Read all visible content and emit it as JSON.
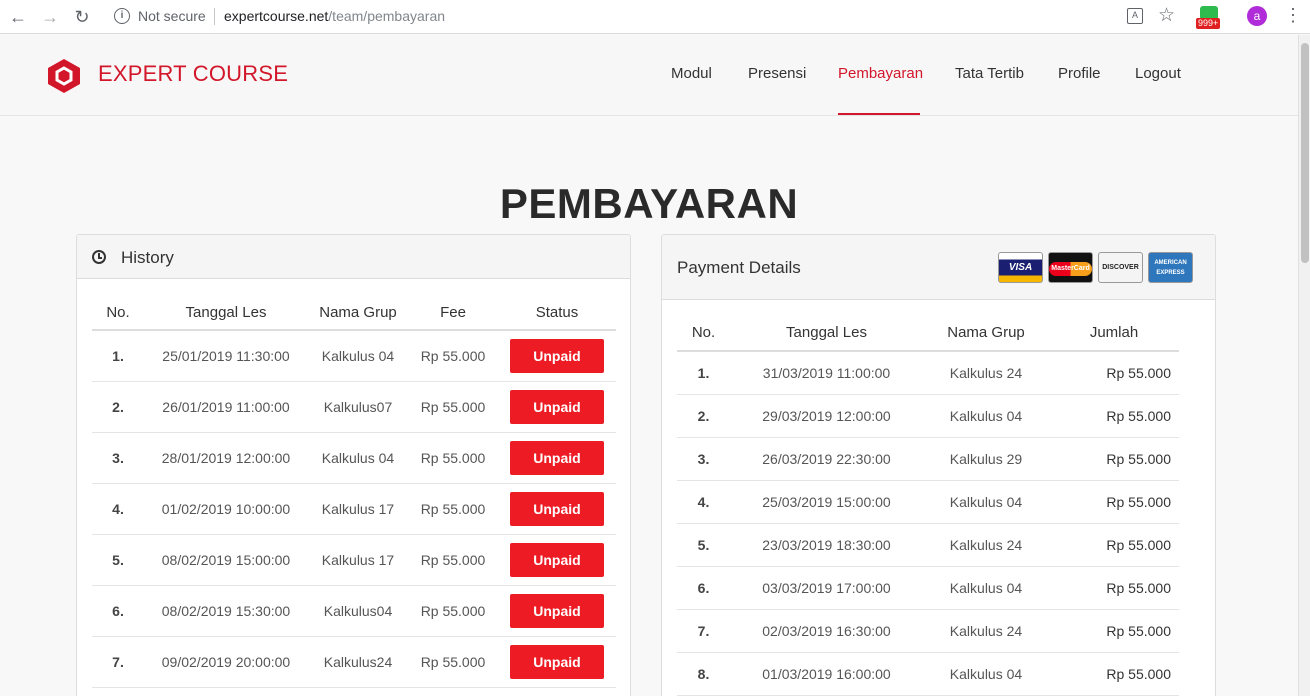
{
  "browser": {
    "security_text": "Not secure",
    "url_domain": "expertcourse.net",
    "url_path": "/team/pembayaran",
    "extension_badge": "999+",
    "avatar_letter": "a"
  },
  "brand": {
    "name": "EXPERT COURSE",
    "color": "#d3172b"
  },
  "nav": {
    "items": [
      "Modul",
      "Presensi",
      "Pembayaran",
      "Tata Tertib",
      "Profile",
      "Logout"
    ],
    "active": "Pembayaran"
  },
  "page_title": "PEMBAYARAN",
  "history": {
    "title": "History",
    "columns": [
      "No.",
      "Tanggal Les",
      "Nama Grup",
      "Fee",
      "Status"
    ],
    "rows": [
      {
        "no": "1.",
        "date": "25/01/2019 11:30:00",
        "group": "Kalkulus 04",
        "fee": "Rp 55.000",
        "status": "Unpaid"
      },
      {
        "no": "2.",
        "date": "26/01/2019 11:00:00",
        "group": "Kalkulus07",
        "fee": "Rp 55.000",
        "status": "Unpaid"
      },
      {
        "no": "3.",
        "date": "28/01/2019 12:00:00",
        "group": "Kalkulus 04",
        "fee": "Rp 55.000",
        "status": "Unpaid"
      },
      {
        "no": "4.",
        "date": "01/02/2019 10:00:00",
        "group": "Kalkulus 17",
        "fee": "Rp 55.000",
        "status": "Unpaid"
      },
      {
        "no": "5.",
        "date": "08/02/2019 15:00:00",
        "group": "Kalkulus 17",
        "fee": "Rp 55.000",
        "status": "Unpaid"
      },
      {
        "no": "6.",
        "date": "08/02/2019 15:30:00",
        "group": "Kalkulus04",
        "fee": "Rp 55.000",
        "status": "Unpaid"
      },
      {
        "no": "7.",
        "date": "09/02/2019 20:00:00",
        "group": "Kalkulus24",
        "fee": "Rp 55.000",
        "status": "Unpaid"
      }
    ],
    "status_color": "#ed1c24"
  },
  "payment": {
    "title": "Payment Details",
    "cards": {
      "visa": "VISA",
      "mastercard": "MasterCard",
      "discover": "DISCOVER",
      "amex_line1": "AMERICAN",
      "amex_line2": "EXPRESS"
    },
    "columns": [
      "No.",
      "Tanggal Les",
      "Nama Grup",
      "Jumlah"
    ],
    "rows": [
      {
        "no": "1.",
        "date": "31/03/2019 11:00:00",
        "group": "Kalkulus 24",
        "amount": "Rp 55.000"
      },
      {
        "no": "2.",
        "date": "29/03/2019 12:00:00",
        "group": "Kalkulus 04",
        "amount": "Rp 55.000"
      },
      {
        "no": "3.",
        "date": "26/03/2019 22:30:00",
        "group": "Kalkulus 29",
        "amount": "Rp 55.000"
      },
      {
        "no": "4.",
        "date": "25/03/2019 15:00:00",
        "group": "Kalkulus 04",
        "amount": "Rp 55.000"
      },
      {
        "no": "5.",
        "date": "23/03/2019 18:30:00",
        "group": "Kalkulus 24",
        "amount": "Rp 55.000"
      },
      {
        "no": "6.",
        "date": "03/03/2019 17:00:00",
        "group": "Kalkulus 04",
        "amount": "Rp 55.000"
      },
      {
        "no": "7.",
        "date": "02/03/2019 16:30:00",
        "group": "Kalkulus 24",
        "amount": "Rp 55.000"
      },
      {
        "no": "8.",
        "date": "01/03/2019 16:00:00",
        "group": "Kalkulus 04",
        "amount": "Rp 55.000"
      }
    ]
  }
}
